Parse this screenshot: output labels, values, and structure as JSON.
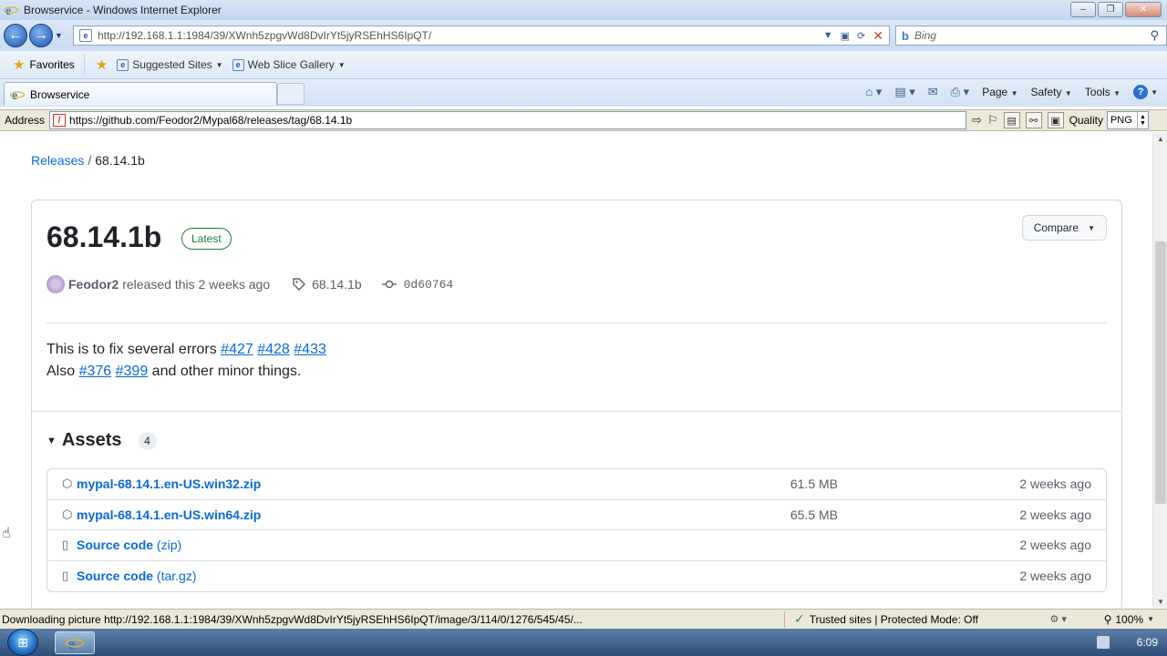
{
  "window": {
    "title": "Browservice - Windows Internet Explorer",
    "minimize": "–",
    "maximize": "❐",
    "close": "✕"
  },
  "navbar": {
    "back": "←",
    "forward": "→",
    "url": "http://192.168.1.1:1984/39/XWnh5zpgvWd8DvIrYt5jyRSEhHS6IpQT/",
    "search_placeholder": "Bing"
  },
  "favorites_bar": {
    "favorites_label": "Favorites",
    "suggested_sites": "Suggested Sites",
    "web_slice_gallery": "Web Slice Gallery"
  },
  "tabs": {
    "active_tab": "Browservice"
  },
  "command_bar": {
    "page": "Page",
    "safety": "Safety",
    "tools": "Tools"
  },
  "browservice_bar": {
    "address_label": "Address",
    "address_value": "https://github.com/Feodor2/Mypal68/releases/tag/68.14.1b",
    "quality_label": "Quality",
    "quality_value": "PNG"
  },
  "page": {
    "breadcrumb": {
      "releases": "Releases",
      "separator": "/",
      "current": "68.14.1b"
    },
    "release": {
      "title": "68.14.1b",
      "badge": "Latest",
      "compare_label": "Compare",
      "author": "Feodor2",
      "released_text": "released this 2 weeks ago",
      "tag": "68.14.1b",
      "commit": "0d60764",
      "body_line1_text": "This is to fix several errors",
      "body_line1_links": [
        "#427",
        "#428",
        "#433"
      ],
      "body_line2_prefix": "Also",
      "body_line2_links": [
        "#376",
        "#399"
      ],
      "body_line2_suffix": "and other minor things."
    },
    "assets": {
      "title": "Assets",
      "count": "4",
      "items": [
        {
          "name": "mypal-68.14.1.en-US.win32.zip",
          "sub": "",
          "size": "61.5 MB",
          "date": "2 weeks ago"
        },
        {
          "name": "mypal-68.14.1.en-US.win64.zip",
          "sub": "",
          "size": "65.5 MB",
          "date": "2 weeks ago"
        },
        {
          "name": "Source code",
          "sub": "(zip)",
          "size": "",
          "date": "2 weeks ago"
        },
        {
          "name": "Source code",
          "sub": "(tar.gz)",
          "size": "",
          "date": "2 weeks ago"
        }
      ]
    }
  },
  "status_bar": {
    "message": "Downloading picture http://192.168.1.1:1984/39/XWnh5zpgvWd8DvIrYt5jyRSEhHS6IpQT/image/3/114/0/1276/545/45/...",
    "zone": "Trusted sites | Protected Mode: Off",
    "zoom": "100%"
  },
  "taskbar": {
    "clock": "6:09"
  }
}
